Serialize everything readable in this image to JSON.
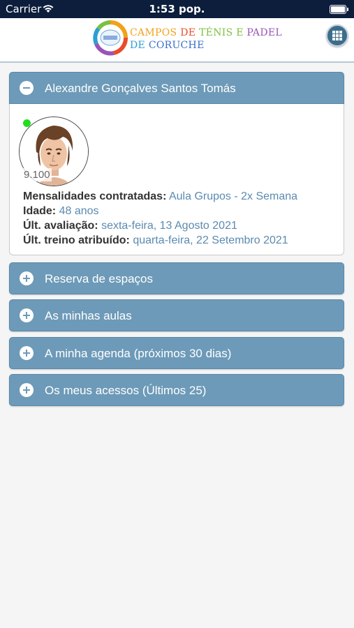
{
  "status_bar": {
    "carrier": "Carrier",
    "time": "1:53 pop."
  },
  "header": {
    "logo_icon": "club-logo",
    "brand_line1": [
      "CAMPOS",
      "DE",
      "TÉNIS E",
      "PADEL"
    ],
    "brand_line2": [
      "DE",
      "CORUCHE"
    ],
    "menu_icon": "grid-menu-icon"
  },
  "profile": {
    "name": "Alexandre Gonçalves Santos Tomás",
    "score": "9.100",
    "online": true,
    "fields": [
      {
        "label": "Mensalidades contratadas:",
        "value": "Aula Grupos - 2x Semana"
      },
      {
        "label": "Idade:",
        "value": "48 anos"
      },
      {
        "label": "Últ. avaliação:",
        "value": "sexta-feira, 13 Agosto 2021"
      },
      {
        "label": "Últ. treino atribuído:",
        "value": "quarta-feira, 22 Setembro 2021"
      }
    ]
  },
  "sections": [
    {
      "title": "Reserva de espaços"
    },
    {
      "title": "As minhas aulas"
    },
    {
      "title": "A minha agenda (próximos 30 dias)"
    },
    {
      "title": "Os meus acessos (Últimos 25)"
    }
  ],
  "colors": {
    "panel_header": "#6d9ab8",
    "value_text": "#5b8ab0",
    "status_bar": "#0c1e3c"
  }
}
